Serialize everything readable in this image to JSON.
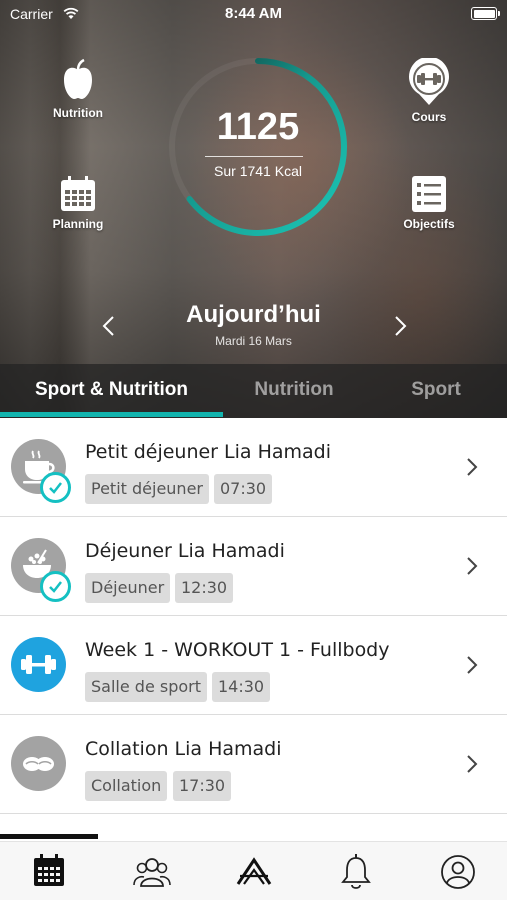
{
  "status_bar": {
    "carrier": "Carrier",
    "time": "8:44 AM"
  },
  "shortcuts": {
    "nutrition": "Nutrition",
    "cours": "Cours",
    "planning": "Planning",
    "objectifs": "Objectifs"
  },
  "calories": {
    "value": "1125",
    "goal_text": "Sur 1741 Kcal",
    "consumed": 1125,
    "goal": 1741
  },
  "day": {
    "title": "Aujourd’hui",
    "date": "Mardi 16 Mars"
  },
  "tabs": [
    {
      "label": "Sport & Nutrition",
      "active": true
    },
    {
      "label": "Nutrition",
      "active": false
    },
    {
      "label": "Sport",
      "active": false
    }
  ],
  "items": [
    {
      "title": "Petit déjeuner Lia Hamadi",
      "category": "Petit déjeuner",
      "time": "07:30",
      "icon": "coffee-cup-icon",
      "done": true
    },
    {
      "title": "Déjeuner Lia Hamadi",
      "category": "Déjeuner",
      "time": "12:30",
      "icon": "bowl-icon",
      "done": true
    },
    {
      "title": "Week 1 - WORKOUT 1 - Fullbody",
      "category": "Salle de sport",
      "time": "14:30",
      "icon": "dumbbell-icon",
      "done": false
    },
    {
      "title": "Collation Lia Hamadi",
      "category": "Collation",
      "time": "17:30",
      "icon": "snack-icon",
      "done": false
    }
  ],
  "colors": {
    "accent": "#12b4ae",
    "workout": "#1fa3df",
    "meal_icon": "#a3a3a3",
    "tag_bg": "#dcdcdc"
  },
  "bottom_nav": [
    "calendar-icon",
    "community-icon",
    "logo-icon",
    "bell-icon",
    "profile-icon"
  ]
}
